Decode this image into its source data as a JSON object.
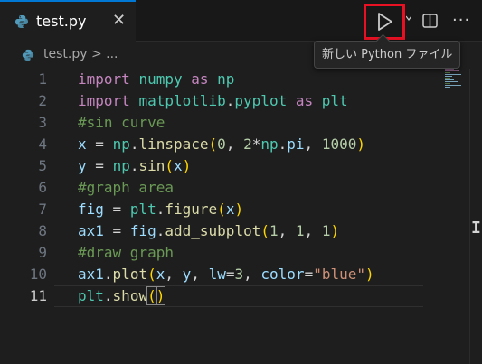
{
  "tab": {
    "filename": "test.py",
    "close_glyph": "✕"
  },
  "toolbar": {
    "run_icon": "play-icon",
    "more_glyph": "···"
  },
  "tooltip": {
    "text": "新しい Python ファイル"
  },
  "breadcrumb": {
    "path": "test.py > ..."
  },
  "editor": {
    "active_line": 11,
    "lines": [
      {
        "n": "1",
        "code": "import numpy as np"
      },
      {
        "n": "2",
        "code": "import matplotlib.pyplot as plt"
      },
      {
        "n": "3",
        "code": "#sin curve"
      },
      {
        "n": "4",
        "code": "x = np.linspace(0, 2*np.pi, 1000)"
      },
      {
        "n": "5",
        "code": "y = np.sin(x)"
      },
      {
        "n": "6",
        "code": "#graph area"
      },
      {
        "n": "7",
        "code": "fig = plt.figure(x)"
      },
      {
        "n": "8",
        "code": "ax1 = fig.add_subplot(1, 1, 1)"
      },
      {
        "n": "9",
        "code": "#draw graph"
      },
      {
        "n": "10",
        "code": "ax1.plot(x, y, lw=3, color=\"blue\")"
      },
      {
        "n": "11",
        "code": "plt.show()"
      }
    ]
  },
  "colors": {
    "accent": "#0078d4",
    "highlight": "#e81123"
  }
}
